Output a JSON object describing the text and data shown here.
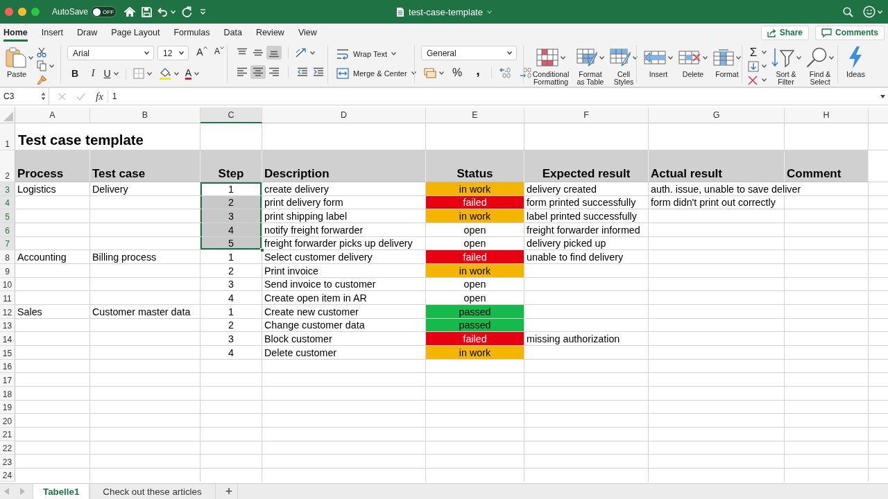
{
  "title_bar": {
    "autosave_label": "AutoSave",
    "autosave_toggle": {
      "label": "OFF",
      "on": false
    },
    "title": "test-case-template"
  },
  "ribbon_tabs": [
    {
      "label": "Home",
      "selected": true
    },
    {
      "label": "Insert",
      "selected": false
    },
    {
      "label": "Draw",
      "selected": false
    },
    {
      "label": "Page Layout",
      "selected": false
    },
    {
      "label": "Formulas",
      "selected": false
    },
    {
      "label": "Data",
      "selected": false
    },
    {
      "label": "Review",
      "selected": false
    },
    {
      "label": "View",
      "selected": false
    }
  ],
  "share_button": {
    "label": "Share"
  },
  "comments_button": {
    "label": "Comments"
  },
  "ribbon": {
    "paste": {
      "label": "Paste"
    },
    "font": {
      "name": "Arial",
      "size": "12",
      "grow": "A",
      "shrink": "A",
      "bold": "B",
      "italic": "I",
      "underline": "U",
      "font_color": "A"
    },
    "vertical_align": [
      {
        "kind": "top",
        "selected": false
      },
      {
        "kind": "middle",
        "selected": false
      },
      {
        "kind": "bottom",
        "selected": true
      }
    ],
    "horizontal_align": [
      {
        "kind": "left",
        "selected": false
      },
      {
        "kind": "center",
        "selected": true
      },
      {
        "kind": "right",
        "selected": false
      }
    ],
    "wrap_text": {
      "label": "Wrap Text"
    },
    "merge_center": {
      "label": "Merge & Center"
    },
    "number_format": {
      "value": "General",
      "percent": "%",
      "comma": ","
    },
    "styles": [
      {
        "kind": "conditional",
        "label": "Conditional Formatting"
      },
      {
        "kind": "table",
        "label": "Format as Table"
      },
      {
        "kind": "cell_styles",
        "label": "Cell Styles"
      }
    ],
    "cells": [
      {
        "kind": "insert",
        "label": "Insert"
      },
      {
        "kind": "delete",
        "label": "Delete"
      },
      {
        "kind": "format",
        "label": "Format"
      }
    ],
    "autosum": "Σ",
    "sort_filter": {
      "label": "Sort & Filter"
    },
    "find_select": {
      "label": "Find & Select"
    },
    "ideas": {
      "label": "Ideas"
    }
  },
  "formula_bar": {
    "name_box": "C3",
    "function_button": "fx",
    "formula": "1"
  },
  "columns": [
    {
      "label": "A",
      "selected": false
    },
    {
      "label": "B",
      "selected": false
    },
    {
      "label": "C",
      "selected": true
    },
    {
      "label": "D",
      "selected": false
    },
    {
      "label": "E",
      "selected": false
    },
    {
      "label": "F",
      "selected": false
    },
    {
      "label": "G",
      "selected": false
    },
    {
      "label": "H",
      "selected": false
    }
  ],
  "rows": [
    {
      "number": "1",
      "kind": "title",
      "selected": false,
      "title": {
        "text": "Test case template",
        "selected": false,
        "active": false
      }
    },
    {
      "number": "2",
      "kind": "header",
      "selected": false,
      "cells": {
        "process": {
          "text": "Process",
          "selected": false,
          "active": false
        },
        "test_case": {
          "text": "Test case",
          "selected": false,
          "active": false
        },
        "step": {
          "text": "Step",
          "selected": false,
          "active": false
        },
        "description": {
          "text": "Description",
          "selected": false,
          "active": false
        },
        "status": {
          "text": "Status",
          "selected": false,
          "active": false
        },
        "expected_result": {
          "text": "Expected result",
          "selected": false,
          "active": false
        },
        "actual_result": {
          "text": "Actual result",
          "selected": false,
          "active": false
        },
        "comment": {
          "text": "Comment",
          "selected": false,
          "active": false
        }
      }
    },
    {
      "number": "3",
      "kind": "data",
      "selected": true,
      "cells": {
        "process": {
          "text": "Logistics",
          "selected": false,
          "active": false
        },
        "test_case": {
          "text": "Delivery",
          "selected": false,
          "active": false
        },
        "step": {
          "text": "1",
          "selected": false,
          "active": true
        },
        "description": {
          "text": "create delivery",
          "selected": false,
          "active": false
        },
        "status": {
          "text": "in work",
          "color": "#f4b400",
          "selected": false,
          "active": false
        },
        "expected_result": {
          "text": "delivery created",
          "selected": false,
          "active": false
        },
        "actual_result": {
          "text": "auth. issue, unable to save deliver",
          "selected": false,
          "active": false
        }
      }
    },
    {
      "number": "4",
      "kind": "data",
      "selected": true,
      "cells": {
        "step": {
          "text": "2",
          "selected": true,
          "active": false
        },
        "description": {
          "text": "print delivery form",
          "selected": false,
          "active": false
        },
        "status": {
          "text": "failed",
          "color": "#e60012",
          "selected": false,
          "active": false
        },
        "expected_result": {
          "text": "form printed successfully",
          "selected": false,
          "active": false
        },
        "actual_result": {
          "text": "form didn't print out correctly",
          "selected": false,
          "active": false
        }
      }
    },
    {
      "number": "5",
      "kind": "data",
      "selected": true,
      "cells": {
        "step": {
          "text": "3",
          "selected": true,
          "active": false
        },
        "description": {
          "text": "print shipping label",
          "selected": false,
          "active": false
        },
        "status": {
          "text": "in work",
          "color": "#f4b400",
          "selected": false,
          "active": false
        },
        "expected_result": {
          "text": "label printed successfully",
          "selected": false,
          "active": false
        }
      }
    },
    {
      "number": "6",
      "kind": "data",
      "selected": true,
      "cells": {
        "step": {
          "text": "4",
          "selected": true,
          "active": false
        },
        "description": {
          "text": "notify freight forwarder",
          "selected": false,
          "active": false
        },
        "status": {
          "text": "open",
          "color": "#ffffff",
          "selected": false,
          "active": false
        },
        "expected_result": {
          "text": "freight forwarder informed",
          "selected": false,
          "active": false
        }
      }
    },
    {
      "number": "7",
      "kind": "data",
      "selected": true,
      "cells": {
        "step": {
          "text": "5",
          "selected": true,
          "active": false
        },
        "description": {
          "text": "freight forwarder picks up delivery",
          "selected": false,
          "active": false
        },
        "status": {
          "text": "open",
          "color": "#ffffff",
          "selected": false,
          "active": false
        },
        "expected_result": {
          "text": "delivery picked up",
          "selected": false,
          "active": false
        }
      }
    },
    {
      "number": "8",
      "kind": "data",
      "selected": false,
      "cells": {
        "process": {
          "text": "Accounting",
          "selected": false,
          "active": false
        },
        "test_case": {
          "text": "Billing process",
          "selected": false,
          "active": false
        },
        "step": {
          "text": "1",
          "selected": false,
          "active": false
        },
        "description": {
          "text": "Select customer delivery",
          "selected": false,
          "active": false
        },
        "status": {
          "text": "failed",
          "color": "#e60012",
          "selected": false,
          "active": false
        },
        "expected_result": {
          "text": "unable to find delivery",
          "selected": false,
          "active": false
        }
      }
    },
    {
      "number": "9",
      "kind": "data",
      "selected": false,
      "cells": {
        "step": {
          "text": "2",
          "selected": false,
          "active": false
        },
        "description": {
          "text": "Print invoice",
          "selected": false,
          "active": false
        },
        "status": {
          "text": "in work",
          "color": "#f4b400",
          "selected": false,
          "active": false
        }
      }
    },
    {
      "number": "10",
      "kind": "data",
      "selected": false,
      "cells": {
        "step": {
          "text": "3",
          "selected": false,
          "active": false
        },
        "description": {
          "text": "Send invoice to customer",
          "selected": false,
          "active": false
        },
        "status": {
          "text": "open",
          "color": "#ffffff",
          "selected": false,
          "active": false
        }
      }
    },
    {
      "number": "11",
      "kind": "data",
      "selected": false,
      "cells": {
        "step": {
          "text": "4",
          "selected": false,
          "active": false
        },
        "description": {
          "text": "Create open item in AR",
          "selected": false,
          "active": false
        },
        "status": {
          "text": "open",
          "color": "#ffffff",
          "selected": false,
          "active": false
        }
      }
    },
    {
      "number": "12",
      "kind": "data",
      "selected": false,
      "cells": {
        "process": {
          "text": "Sales",
          "selected": false,
          "active": false
        },
        "test_case": {
          "text": "Customer master data",
          "selected": false,
          "active": false
        },
        "step": {
          "text": "1",
          "selected": false,
          "active": false
        },
        "description": {
          "text": "Create new customer",
          "selected": false,
          "active": false
        },
        "status": {
          "text": "passed",
          "color": "#16b94b",
          "selected": false,
          "active": false
        }
      }
    },
    {
      "number": "13",
      "kind": "data",
      "selected": false,
      "cells": {
        "step": {
          "text": "2",
          "selected": false,
          "active": false
        },
        "description": {
          "text": "Change customer data",
          "selected": false,
          "active": false
        },
        "status": {
          "text": "passed",
          "color": "#16b94b",
          "selected": false,
          "active": false
        }
      }
    },
    {
      "number": "14",
      "kind": "data",
      "selected": false,
      "cells": {
        "step": {
          "text": "3",
          "selected": false,
          "active": false
        },
        "description": {
          "text": "Block customer",
          "selected": false,
          "active": false
        },
        "status": {
          "text": "failed",
          "color": "#e60012",
          "selected": false,
          "active": false
        },
        "expected_result": {
          "text": "missing authorization",
          "selected": false,
          "active": false
        }
      }
    },
    {
      "number": "15",
      "kind": "data",
      "selected": false,
      "cells": {
        "step": {
          "text": "4",
          "selected": false,
          "active": false
        },
        "description": {
          "text": "Delete customer",
          "selected": false,
          "active": false
        },
        "status": {
          "text": "in work",
          "color": "#f4b400",
          "selected": false,
          "active": false
        }
      }
    },
    {
      "number": "16",
      "kind": "data",
      "selected": false
    },
    {
      "number": "17",
      "kind": "data",
      "selected": false
    },
    {
      "number": "18",
      "kind": "data",
      "selected": false
    },
    {
      "number": "19",
      "kind": "data",
      "selected": false
    },
    {
      "number": "20",
      "kind": "data",
      "selected": false
    },
    {
      "number": "21",
      "kind": "data",
      "selected": false
    },
    {
      "number": "22",
      "kind": "data",
      "selected": false
    },
    {
      "number": "23",
      "kind": "data",
      "selected": false
    },
    {
      "number": "24",
      "kind": "data",
      "selected": false
    }
  ],
  "sheet_tabs": [
    {
      "label": "Tabelle1",
      "selected": true
    },
    {
      "label": "Check out these articles",
      "selected": false
    }
  ],
  "add_sheet_button": "+"
}
